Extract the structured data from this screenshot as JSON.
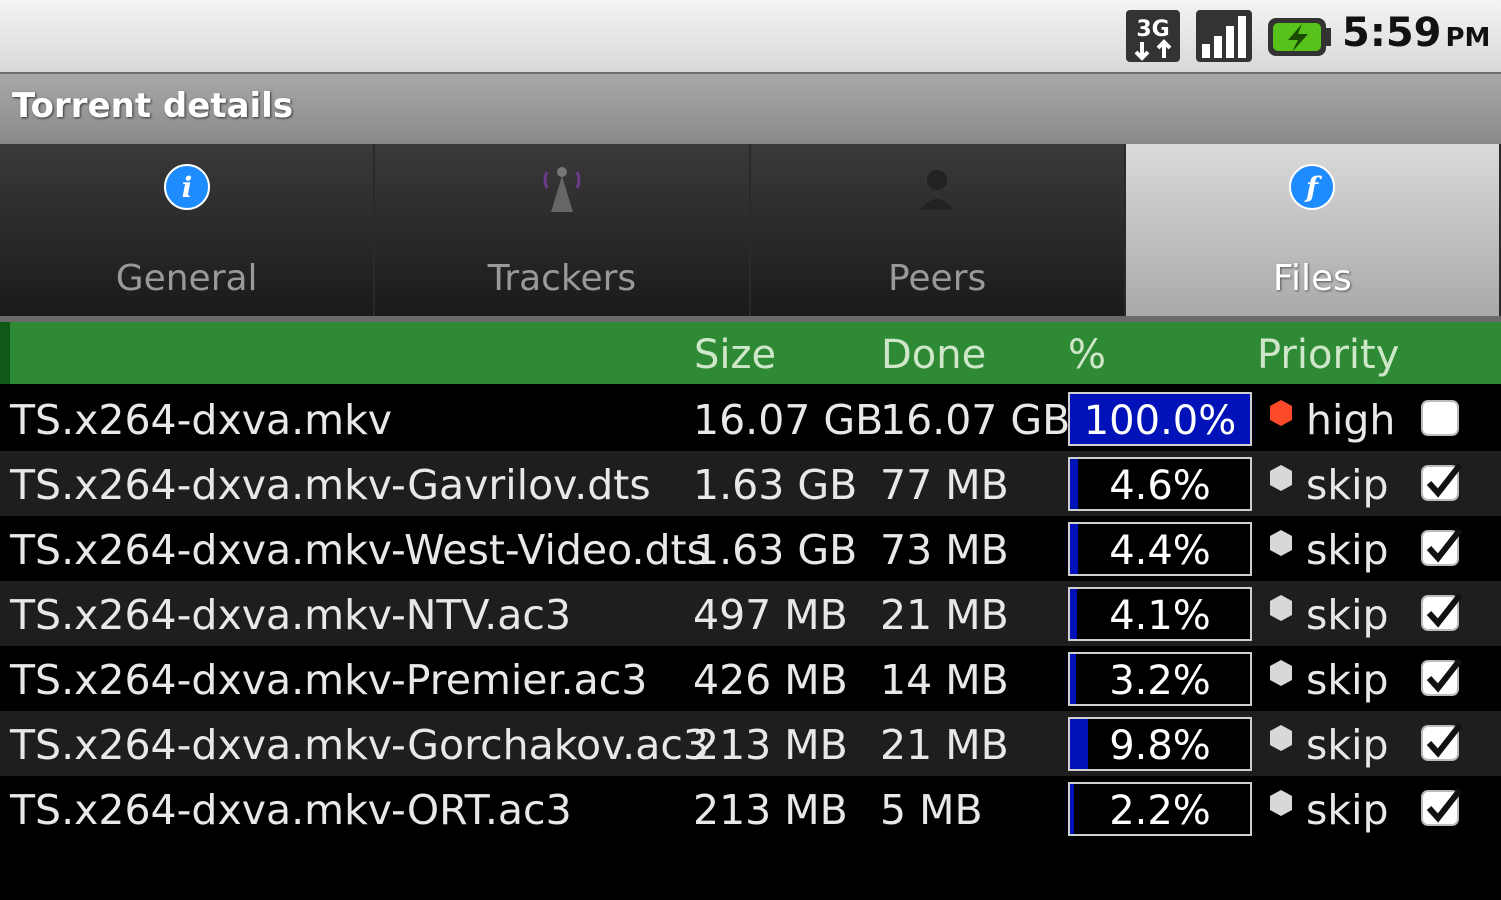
{
  "status_bar": {
    "network": "3G",
    "time": "5:59",
    "ampm": "PM",
    "icons": [
      "3g-data-icon",
      "signal-strength-icon",
      "battery-charging-icon"
    ]
  },
  "title": "Torrent details",
  "tabs": [
    {
      "label": "General",
      "icon": "info-icon",
      "active": false
    },
    {
      "label": "Trackers",
      "icon": "tracker-icon",
      "active": false
    },
    {
      "label": "Peers",
      "icon": "peer-icon",
      "active": false
    },
    {
      "label": "Files",
      "icon": "files-icon",
      "active": true
    }
  ],
  "table": {
    "headers": {
      "size": "Size",
      "done": "Done",
      "percent": "%",
      "priority": "Priority"
    },
    "rows": [
      {
        "name": "TS.x264-dxva.mkv",
        "size": "16.07 GB",
        "done": "16.07 GB",
        "percent": "100.0%",
        "progress": 1.0,
        "priority": "high",
        "checked": false
      },
      {
        "name": "TS.x264-dxva.mkv-Gavrilov.dts",
        "size": "1.63 GB",
        "done": "77 MB",
        "percent": "4.6%",
        "progress": 0.046,
        "priority": "skip",
        "checked": true
      },
      {
        "name": "TS.x264-dxva.mkv-West-Video.dts",
        "size": "1.63 GB",
        "done": "73 MB",
        "percent": "4.4%",
        "progress": 0.044,
        "priority": "skip",
        "checked": true
      },
      {
        "name": "TS.x264-dxva.mkv-NTV.ac3",
        "size": "497 MB",
        "done": "21 MB",
        "percent": "4.1%",
        "progress": 0.041,
        "priority": "skip",
        "checked": true
      },
      {
        "name": "TS.x264-dxva.mkv-Premier.ac3",
        "size": "426 MB",
        "done": "14 MB",
        "percent": "3.2%",
        "progress": 0.032,
        "priority": "skip",
        "checked": true
      },
      {
        "name": "TS.x264-dxva.mkv-Gorchakov.ac3",
        "size": "213 MB",
        "done": "21 MB",
        "percent": "9.8%",
        "progress": 0.098,
        "priority": "skip",
        "checked": true
      },
      {
        "name": "TS.x264-dxva.mkv-ORT.ac3",
        "size": "213 MB",
        "done": "5 MB",
        "percent": "2.2%",
        "progress": 0.022,
        "priority": "skip",
        "checked": true
      }
    ]
  },
  "colors": {
    "header_green": "#2f8a35",
    "progress_blue": "#0012b8",
    "priority_high": "#ff4a2a",
    "priority_skip": "#d8d8d8"
  }
}
